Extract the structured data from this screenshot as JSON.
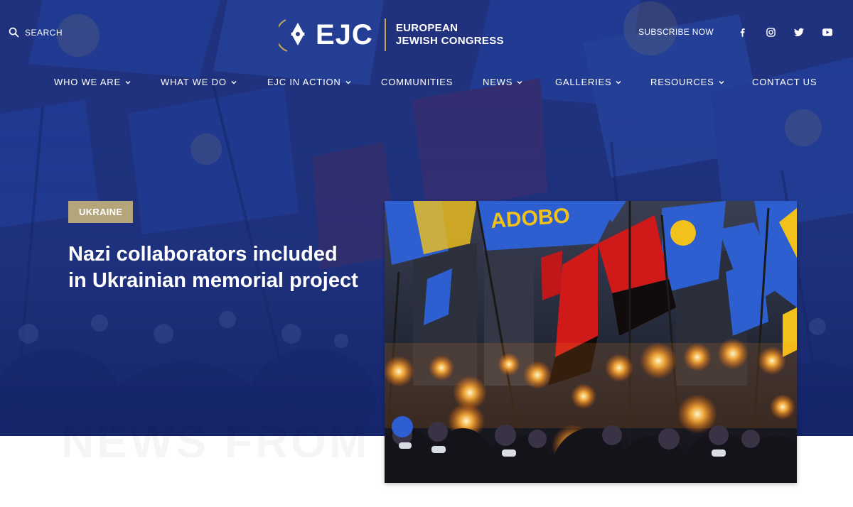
{
  "header": {
    "search_label": "SEARCH",
    "logo": {
      "mark": "EJC",
      "line1": "EUROPEAN",
      "line2": "JEWISH CONGRESS"
    },
    "subscribe_label": "SUBSCRIBE NOW",
    "social": [
      "facebook-icon",
      "instagram-icon",
      "twitter-icon",
      "youtube-icon"
    ]
  },
  "nav": {
    "items": [
      {
        "label": "WHO WE ARE",
        "dropdown": true
      },
      {
        "label": "WHAT WE DO",
        "dropdown": true
      },
      {
        "label": "EJC IN ACTION",
        "dropdown": true
      },
      {
        "label": "COMMUNITIES",
        "dropdown": false
      },
      {
        "label": "NEWS",
        "dropdown": true
      },
      {
        "label": "GALLERIES",
        "dropdown": true
      },
      {
        "label": "RESOURCES",
        "dropdown": true
      },
      {
        "label": "CONTACT US",
        "dropdown": false
      }
    ]
  },
  "hero": {
    "tag": "UKRAINE",
    "headline": "Nazi collaborators included in Ukrainian memorial project"
  },
  "section": {
    "watermark": "NEWS FROM"
  },
  "colors": {
    "overlay_blue": "#1d2f75",
    "tag_gold": "#b5a57a",
    "logo_gold": "#c6a85b",
    "flag_blue": "#2d5fd0",
    "flag_yellow": "#f2c21b",
    "flag_red": "#d01a1a"
  }
}
